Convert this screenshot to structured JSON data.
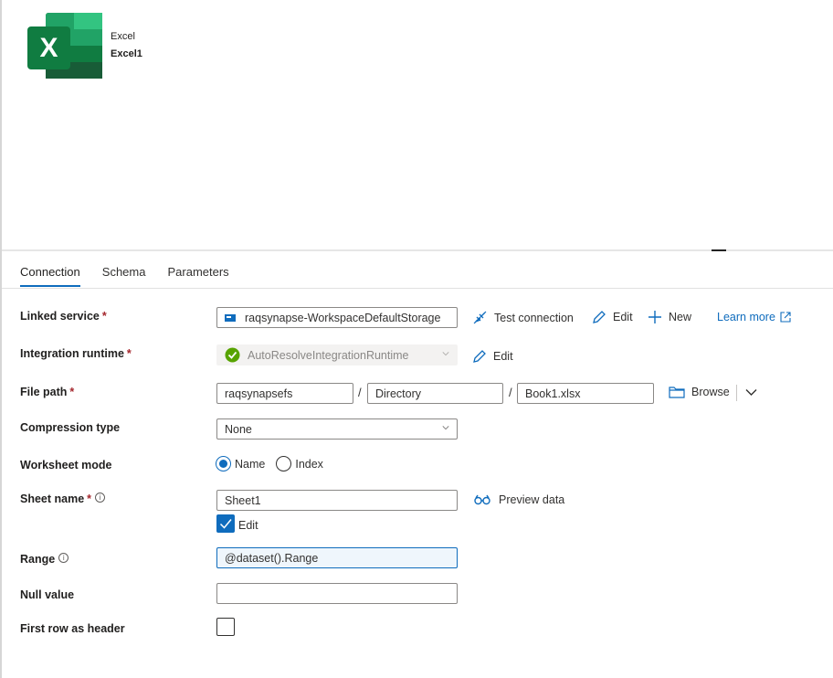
{
  "activity": {
    "type": "Excel",
    "name": "Excel1",
    "icon": "excel-logo-icon"
  },
  "tabs": [
    {
      "label": "Connection",
      "active": true
    },
    {
      "label": "Schema",
      "active": false
    },
    {
      "label": "Parameters",
      "active": false
    }
  ],
  "form": {
    "linked_service": {
      "label": "Linked service",
      "required": "*",
      "value": "raqsynapse-WorkspaceDefaultStorage",
      "icon": "storage-icon",
      "actions": {
        "test_connection": "Test connection",
        "edit": "Edit",
        "new": "New",
        "learn_more": "Learn more"
      }
    },
    "integration_runtime": {
      "label": "Integration runtime",
      "required": "*",
      "value": "AutoResolveIntegrationRuntime",
      "status_icon": "check-circle-icon",
      "edit": "Edit"
    },
    "file_path": {
      "label": "File path",
      "required": "*",
      "container": "raqsynapsefs",
      "directory_placeholder": "Directory",
      "file": "Book1.xlsx",
      "separator": "/",
      "browse": "Browse"
    },
    "compression_type": {
      "label": "Compression type",
      "value": "None"
    },
    "worksheet_mode": {
      "label": "Worksheet mode",
      "options": [
        "Name",
        "Index"
      ],
      "selected": "Name"
    },
    "sheet_name": {
      "label": "Sheet name",
      "required": "*",
      "info": "i",
      "value": "Sheet1",
      "preview": "Preview data",
      "edit_label": "Edit",
      "edit_checked": true
    },
    "range": {
      "label": "Range",
      "info": "i",
      "value": "@dataset().Range"
    },
    "null_value": {
      "label": "Null value",
      "value": ""
    },
    "first_row_header": {
      "label": "First row as header",
      "checked": false
    }
  },
  "colors": {
    "accent": "#0f6cbd",
    "required": "#a4262c",
    "success": "#57a300"
  }
}
